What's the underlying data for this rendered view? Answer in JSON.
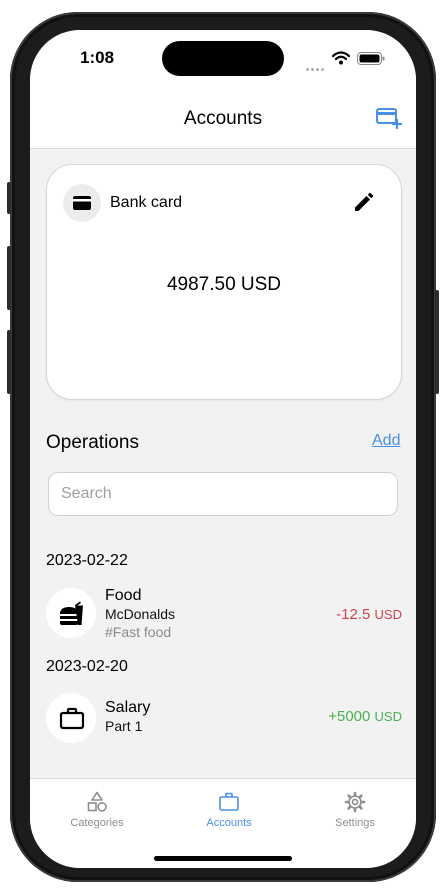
{
  "status": {
    "time": "1:08"
  },
  "header": {
    "title": "Accounts",
    "add_account_icon": "card-plus-icon"
  },
  "account_card": {
    "icon": "credit-card-icon",
    "name": "Bank card",
    "balance": "4987.50 USD",
    "edit_icon": "pencil-icon"
  },
  "operations": {
    "title": "Operations",
    "add_label": "Add",
    "search_placeholder": "Search",
    "groups": [
      {
        "date": "2023-02-22",
        "items": [
          {
            "icon": "fastfood-icon",
            "category": "Food",
            "description": "McDonalds",
            "tag": "#Fast food",
            "amount": "-12.5",
            "currency": "USD",
            "color": "#d0454c"
          }
        ]
      },
      {
        "date": "2023-02-20",
        "items": [
          {
            "icon": "briefcase-icon",
            "category": "Salary",
            "description": "Part 1",
            "tag": "",
            "amount": "+5000",
            "currency": "USD",
            "color": "#4caf50"
          }
        ]
      }
    ]
  },
  "tabs": [
    {
      "label": "Categories",
      "icon": "shapes-icon",
      "active": false
    },
    {
      "label": "Accounts",
      "icon": "briefcase-icon",
      "active": true
    },
    {
      "label": "Settings",
      "icon": "gear-icon",
      "active": false
    }
  ],
  "colors": {
    "accent": "#4a90e2",
    "expense": "#d0454c",
    "income": "#4caf50"
  }
}
